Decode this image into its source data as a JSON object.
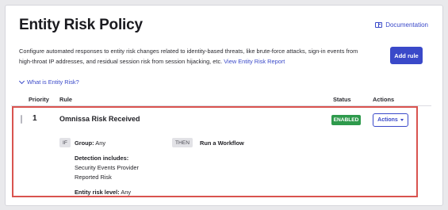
{
  "header": {
    "title": "Entity Risk Policy",
    "documentation_label": "Documentation"
  },
  "description": {
    "text": "Configure automated responses to entity risk changes related to identity-based threats, like brute-force attacks, sign-in events from high-throat IP addresses, and residual session risk from session hijacking, etc.",
    "link": "View Entity Risk Report"
  },
  "add_rule_label": "Add rule",
  "what_is_label": "What is Entity Risk?",
  "table": {
    "columns": [
      "Priority",
      "Rule",
      "Status",
      "Actions"
    ],
    "rows": [
      {
        "priority": "1",
        "rule_name": "Omnissa Risk Received",
        "status": "ENABLED",
        "actions_label": "Actions",
        "if_label": "IF",
        "group_label": "Group:",
        "group_value": "Any",
        "then_label": "THEN",
        "then_action": "Run a Workflow",
        "detection_heading": "Detection includes:",
        "detection_items": [
          "Security Events Provider",
          "Reported Risk"
        ],
        "risk_level_label": "Entity risk level:",
        "risk_level_value": "Any"
      }
    ]
  },
  "colors": {
    "accent": "#3a49c9",
    "status_enabled": "#2e9a4c",
    "highlight_border": "#d9534f"
  }
}
